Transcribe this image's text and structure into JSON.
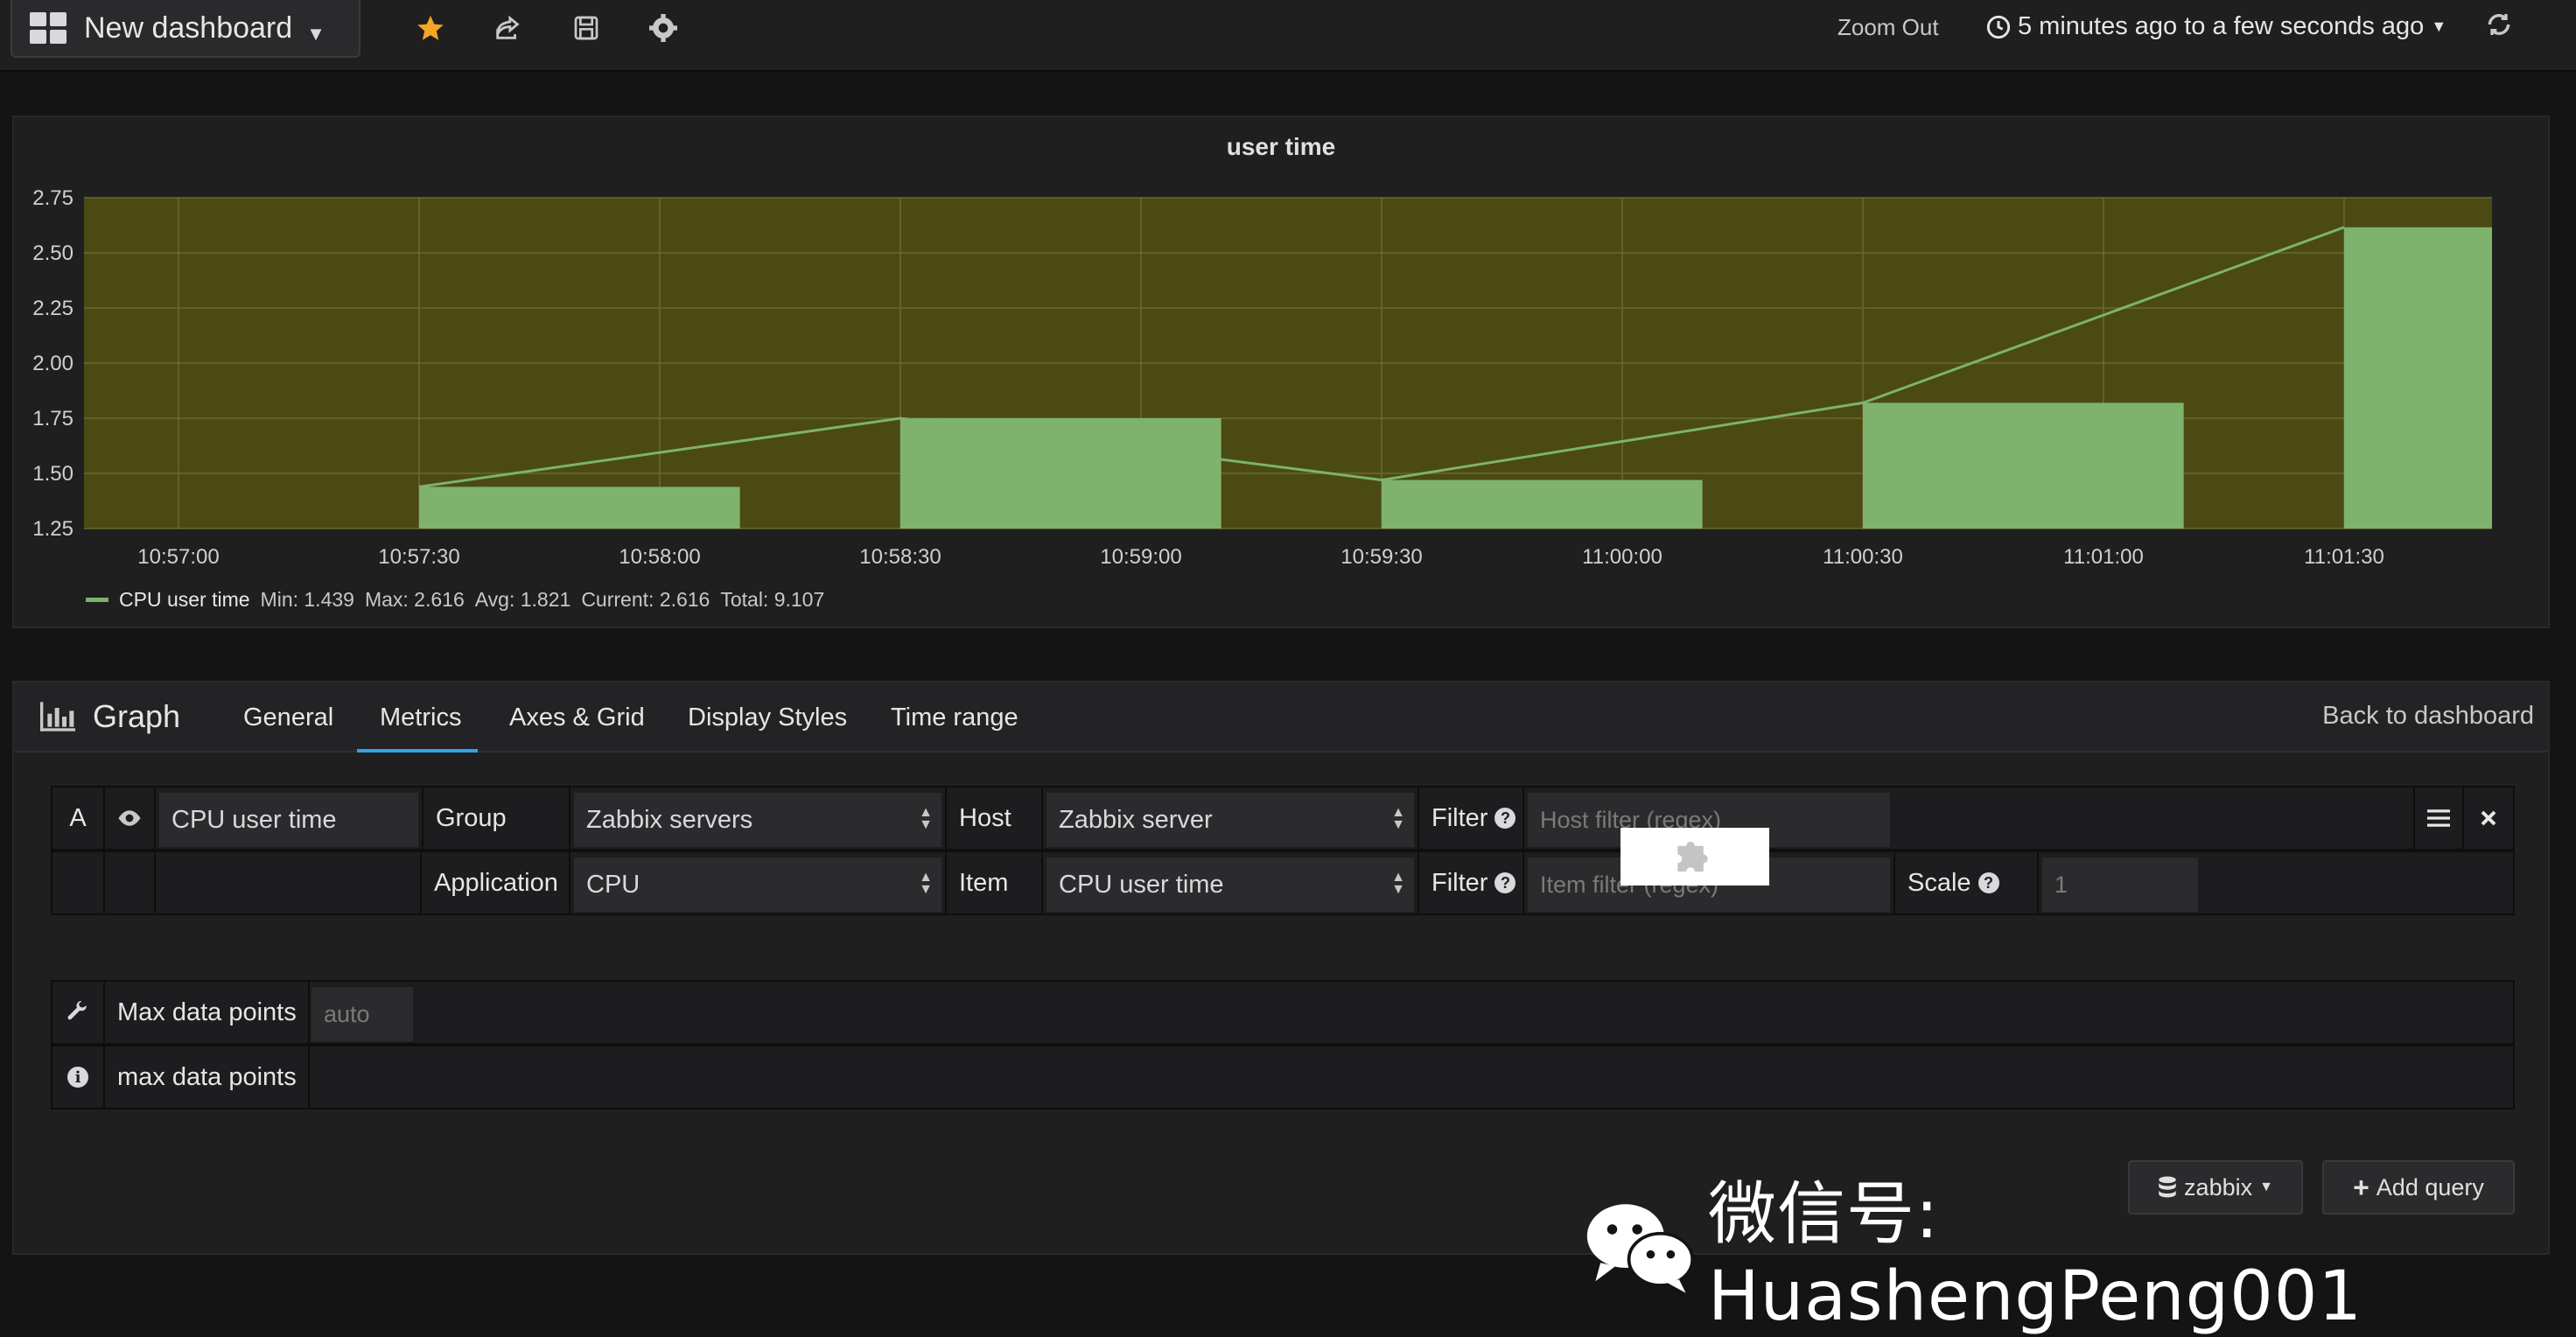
{
  "topnav": {
    "dashboard_title": "New dashboard",
    "zoom_out_label": "Zoom Out",
    "time_range_label": "5 minutes ago to a few seconds ago"
  },
  "panel": {
    "title": "user time",
    "legend": {
      "series_name": "CPU user time",
      "min": "Min: 1.439",
      "max": "Max: 2.616",
      "avg": "Avg: 1.821",
      "current": "Current: 2.616",
      "total": "Total: 9.107"
    }
  },
  "chart_data": {
    "type": "bar",
    "title": "user time",
    "xlabel": "",
    "ylabel": "",
    "ylim": [
      1.25,
      2.75
    ],
    "yticks": [
      "1.25",
      "1.50",
      "1.75",
      "2.00",
      "2.25",
      "2.50",
      "2.75"
    ],
    "xticks": [
      "10:57:00",
      "10:57:30",
      "10:58:00",
      "10:58:30",
      "10:59:00",
      "10:59:30",
      "11:00:00",
      "11:00:30",
      "11:01:00",
      "11:01:30"
    ],
    "grid": true,
    "legend_position": "bottom-left",
    "series": [
      {
        "name": "CPU user time",
        "color": "#7eb26d",
        "bars": [
          {
            "start": "10:57:30",
            "end": "10:58:10",
            "value": 1.439
          },
          {
            "start": "10:58:30",
            "end": "10:59:10",
            "value": 1.75
          },
          {
            "start": "10:59:30",
            "end": "11:00:10",
            "value": 1.47
          },
          {
            "start": "11:00:30",
            "end": "11:01:10",
            "value": 1.82
          },
          {
            "start": "11:01:30",
            "end": "11:02:00",
            "value": 2.616
          }
        ],
        "line_points": [
          {
            "x": "10:57:30",
            "y": 1.439
          },
          {
            "x": "10:58:30",
            "y": 1.75
          },
          {
            "x": "10:59:30",
            "y": 1.47
          },
          {
            "x": "11:00:30",
            "y": 1.82
          },
          {
            "x": "11:01:30",
            "y": 2.616
          }
        ]
      }
    ],
    "background_color": "#4a4a12"
  },
  "editor": {
    "panel_type": "Graph",
    "tabs": [
      {
        "label": "General"
      },
      {
        "label": "Metrics"
      },
      {
        "label": "Axes & Grid"
      },
      {
        "label": "Display Styles"
      },
      {
        "label": "Time range"
      }
    ],
    "active_tab": "Metrics",
    "back_label": "Back to dashboard",
    "query": {
      "ref_id": "A",
      "alias": "CPU user time",
      "group_label": "Group",
      "group_value": "Zabbix servers",
      "host_label": "Host",
      "host_value": "Zabbix server",
      "filter_label": "Filter",
      "host_filter_placeholder": "Host filter (regex)",
      "application_label": "Application",
      "application_value": "CPU",
      "item_label": "Item",
      "item_value": "CPU user time",
      "item_filter_placeholder": "Item filter (regex)",
      "scale_label": "Scale",
      "scale_value": "1"
    },
    "options": {
      "max_points_label": "Max data points",
      "max_points_placeholder": "auto",
      "max_points_info": "max data points"
    },
    "datasource_label": "zabbix",
    "add_query_label": "Add query"
  },
  "watermark": {
    "text": "微信号: HuashengPeng001"
  },
  "colors": {
    "accent": "#33a2e5",
    "star": "#f5a623",
    "series": "#7eb26d"
  }
}
